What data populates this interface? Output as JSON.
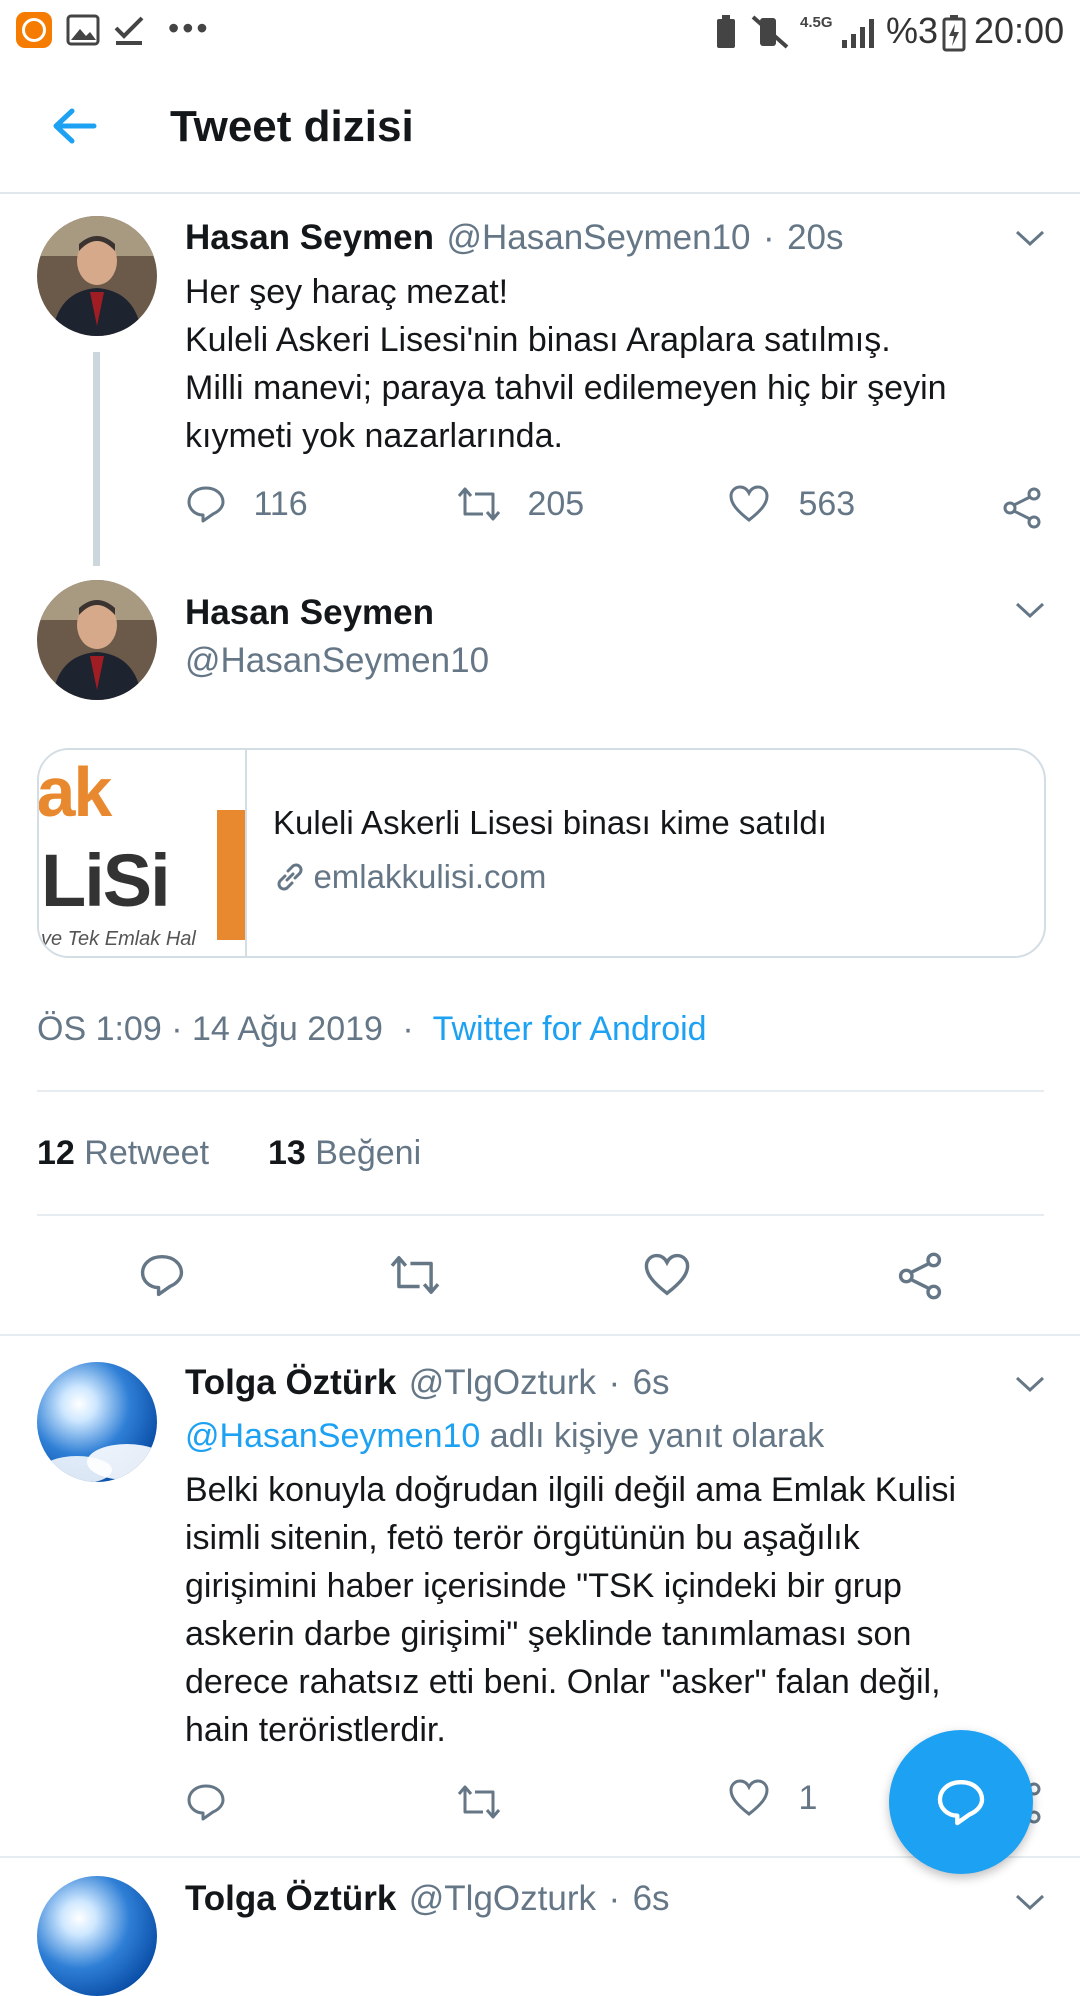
{
  "status_bar": {
    "network": "4.5G",
    "battery": "%3",
    "time": "20:00"
  },
  "header": {
    "title": "Tweet dizisi"
  },
  "tweet1": {
    "name": "Hasan Seymen",
    "handle": "@HasanSeymen10",
    "sep": "·",
    "time": "20s",
    "lines": [
      "Her şey haraç mezat!",
      "Kuleli Askeri Lisesi'nin binası Araplara satılmış.",
      "Milli manevi; paraya tahvil edilemeyen hiç bir şeyin",
      "kıymeti yok nazarlarında."
    ],
    "replies": "116",
    "retweets": "205",
    "likes": "563"
  },
  "main_tweet": {
    "name": "Hasan Seymen",
    "handle": "@HasanSeymen10",
    "card": {
      "thumb_line1": "lak",
      "thumb_line2": "LiSi",
      "thumb_line3": "ve Tek Emlak Hal",
      "title": "Kuleli Askerli Lisesi binası kime satıldı",
      "domain": "emlakkulisi.com"
    },
    "timestamp": "ÖS 1:09 · 14 Ağu 2019",
    "sep": "·",
    "source": "Twitter for Android",
    "retweet_count": "12",
    "retweet_label": "Retweet",
    "like_count": "13",
    "like_label": "Beğeni"
  },
  "reply1": {
    "name": "Tolga Öztürk",
    "handle": "@TlgOzturk",
    "sep": "·",
    "time": "6s",
    "reply_to_handle": "@HasanSeymen10",
    "reply_to_suffix": "adlı kişiye yanıt olarak",
    "lines": [
      "Belki konuyla doğrudan ilgili değil ama Emlak Kulisi",
      "isimli sitenin, fetö terör örgütünün bu aşağılık",
      "girişimini haber içerisinde \"TSK içindeki bir grup",
      "askerin darbe girişimi\" şeklinde tanımlaması son",
      "derece rahatsız etti beni. Onlar \"asker\" falan değil,",
      "hain teröristlerdir."
    ],
    "likes": "1"
  },
  "reply2": {
    "name": "Tolga Öztürk",
    "handle": "@TlgOzturk",
    "sep": "·",
    "time": "6s"
  },
  "colors": {
    "accent": "#1da1f2",
    "text": "#14171a",
    "secondary": "#657786",
    "divider": "#e6ecf0"
  }
}
